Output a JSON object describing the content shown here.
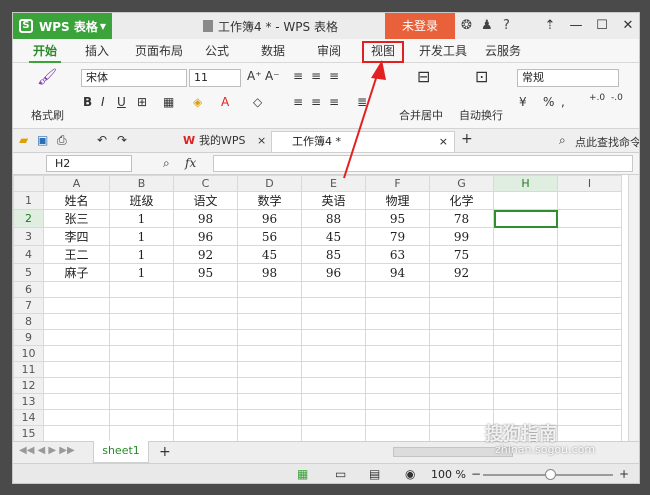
{
  "app": {
    "logo": "WPS 表格",
    "doc_title": "工作簿4 * - WPS 表格",
    "login": "未登录"
  },
  "tabs": [
    "开始",
    "插入",
    "页面布局",
    "公式",
    "数据",
    "审阅",
    "视图",
    "开发工具",
    "云服务"
  ],
  "ribbon": {
    "paste": "格式刷",
    "font_name": "宋体",
    "font_size": "11",
    "merge": "合并居中",
    "wrap": "自动换行",
    "number_format": "常规"
  },
  "qbar": {
    "doc_tab1": "我的WPS",
    "doc_tab2": "工作簿4 *",
    "search": "点此查找命令"
  },
  "formula": {
    "cell_ref": "H2",
    "fx": "fx"
  },
  "sheet": {
    "columns": [
      "A",
      "B",
      "C",
      "D",
      "E",
      "F",
      "G",
      "H",
      "I"
    ],
    "rows": [
      [
        "姓名",
        "班级",
        "语文",
        "数学",
        "英语",
        "物理",
        "化学",
        "",
        ""
      ],
      [
        "张三",
        "1",
        "98",
        "96",
        "88",
        "95",
        "78",
        "",
        ""
      ],
      [
        "李四",
        "1",
        "96",
        "56",
        "45",
        "79",
        "99",
        "",
        ""
      ],
      [
        "王二",
        "1",
        "92",
        "45",
        "85",
        "63",
        "75",
        "",
        ""
      ],
      [
        "麻子",
        "1",
        "95",
        "98",
        "96",
        "94",
        "92",
        "",
        ""
      ],
      [
        "",
        "",
        "",
        "",
        "",
        "",
        "",
        "",
        ""
      ],
      [
        "",
        "",
        "",
        "",
        "",
        "",
        "",
        "",
        ""
      ],
      [
        "",
        "",
        "",
        "",
        "",
        "",
        "",
        "",
        ""
      ],
      [
        "",
        "",
        "",
        "",
        "",
        "",
        "",
        "",
        ""
      ],
      [
        "",
        "",
        "",
        "",
        "",
        "",
        "",
        "",
        ""
      ],
      [
        "",
        "",
        "",
        "",
        "",
        "",
        "",
        "",
        ""
      ],
      [
        "",
        "",
        "",
        "",
        "",
        "",
        "",
        "",
        ""
      ],
      [
        "",
        "",
        "",
        "",
        "",
        "",
        "",
        "",
        ""
      ],
      [
        "",
        "",
        "",
        "",
        "",
        "",
        "",
        "",
        ""
      ],
      [
        "",
        "",
        "",
        "",
        "",
        "",
        "",
        "",
        ""
      ],
      [
        "",
        "",
        "",
        "",
        "",
        "",
        "",
        "",
        ""
      ]
    ],
    "tab": "sheet1"
  },
  "status": {
    "zoom": "100 %"
  },
  "watermark": {
    "line1": "搜狗指南",
    "line2": "zhinan.sogou.com"
  },
  "colors": {
    "accent": "#3aa33a",
    "login_bg": "#e8613a",
    "highlight": "#e32020"
  }
}
